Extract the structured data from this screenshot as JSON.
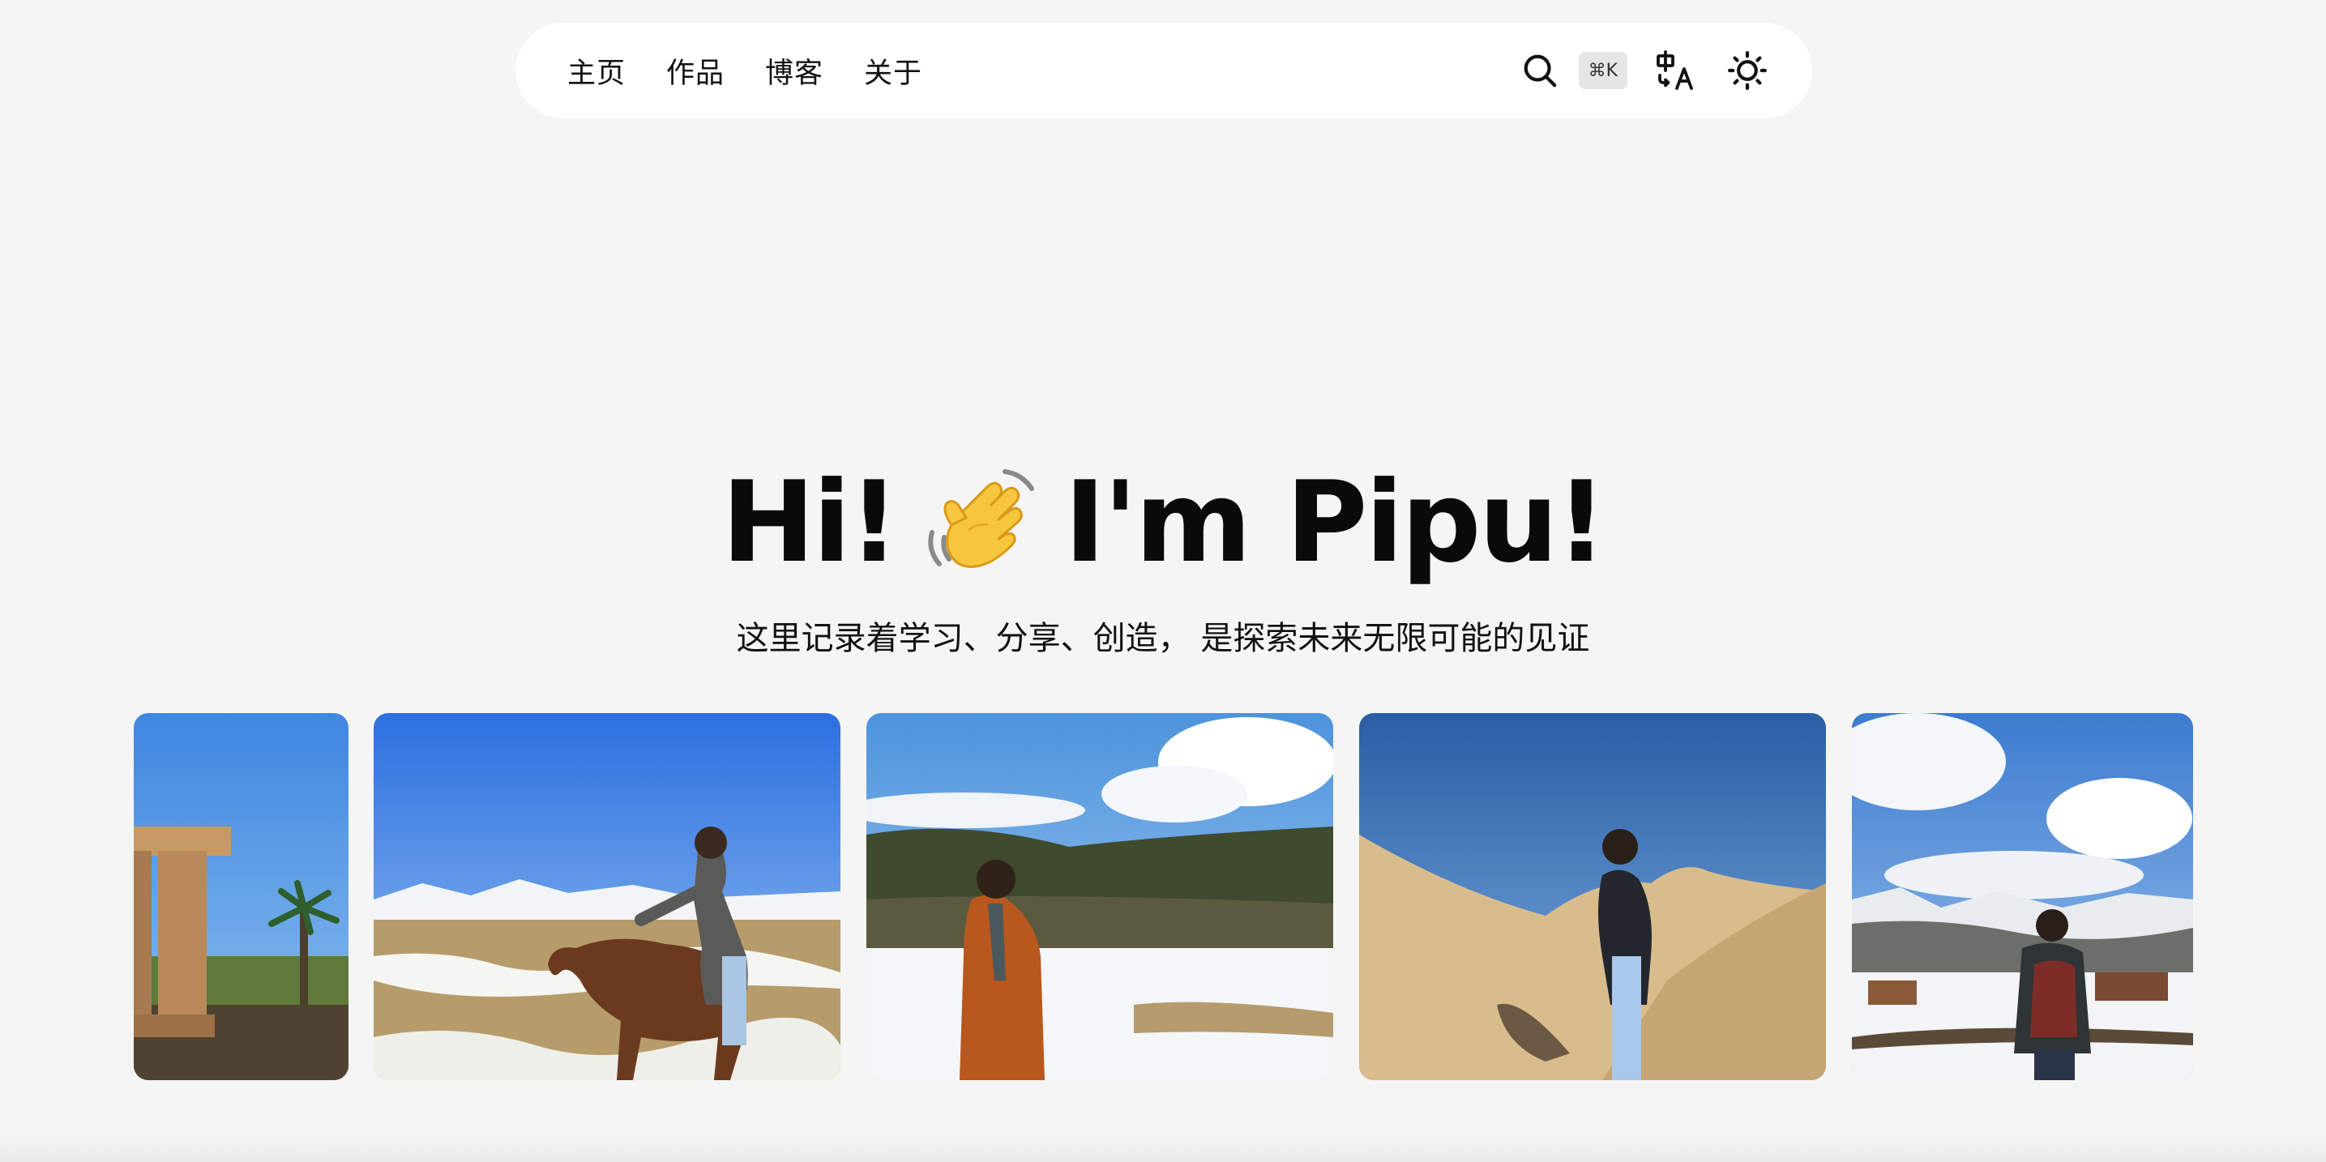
{
  "nav": {
    "links": [
      {
        "label": "主页"
      },
      {
        "label": "作品"
      },
      {
        "label": "博客"
      },
      {
        "label": "关于"
      }
    ],
    "search_shortcut": "⌘K"
  },
  "hero": {
    "greeting_left": "Hi!",
    "greeting_right": "I'm Pipu!",
    "subtitle": "这里记录着学习、分享、创造， 是探索未来无限可能的见证"
  },
  "photos": [
    {
      "icon": "arch-palm-photo"
    },
    {
      "icon": "horse-rider-photo"
    },
    {
      "icon": "snow-forest-photo"
    },
    {
      "icon": "sand-dune-photo"
    },
    {
      "icon": "snow-village-photo"
    }
  ],
  "colors": {
    "background": "#f5f5f5",
    "navbar": "#ffffff",
    "text": "#111111"
  }
}
